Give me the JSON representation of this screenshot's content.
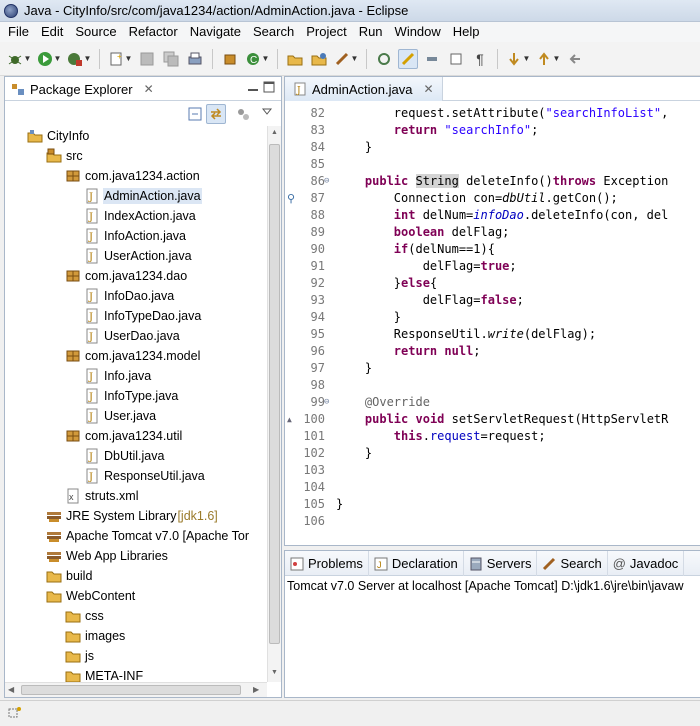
{
  "window": {
    "title": "Java - CityInfo/src/com/java1234/action/AdminAction.java - Eclipse"
  },
  "menu": [
    "File",
    "Edit",
    "Source",
    "Refactor",
    "Navigate",
    "Search",
    "Project",
    "Run",
    "Window",
    "Help"
  ],
  "package_explorer": {
    "title": "Package Explorer",
    "tree": [
      {
        "label": "CityInfo",
        "icon": "project-icon",
        "depth": 0
      },
      {
        "label": "src",
        "icon": "source-folder-icon",
        "depth": 1
      },
      {
        "label": "com.java1234.action",
        "icon": "package-icon",
        "depth": 2
      },
      {
        "label": "AdminAction.java",
        "icon": "java-file-icon",
        "depth": 3,
        "selected": true
      },
      {
        "label": "IndexAction.java",
        "icon": "java-file-icon",
        "depth": 3
      },
      {
        "label": "InfoAction.java",
        "icon": "java-file-icon",
        "depth": 3
      },
      {
        "label": "UserAction.java",
        "icon": "java-file-icon",
        "depth": 3
      },
      {
        "label": "com.java1234.dao",
        "icon": "package-icon",
        "depth": 2
      },
      {
        "label": "InfoDao.java",
        "icon": "java-file-icon",
        "depth": 3
      },
      {
        "label": "InfoTypeDao.java",
        "icon": "java-file-icon",
        "depth": 3
      },
      {
        "label": "UserDao.java",
        "icon": "java-file-icon",
        "depth": 3
      },
      {
        "label": "com.java1234.model",
        "icon": "package-icon",
        "depth": 2
      },
      {
        "label": "Info.java",
        "icon": "java-file-icon",
        "depth": 3
      },
      {
        "label": "InfoType.java",
        "icon": "java-file-icon",
        "depth": 3
      },
      {
        "label": "User.java",
        "icon": "java-file-icon",
        "depth": 3
      },
      {
        "label": "com.java1234.util",
        "icon": "package-icon",
        "depth": 2
      },
      {
        "label": "DbUtil.java",
        "icon": "java-file-icon",
        "depth": 3
      },
      {
        "label": "ResponseUtil.java",
        "icon": "java-file-icon",
        "depth": 3
      },
      {
        "label": "struts.xml",
        "icon": "xml-file-icon",
        "depth": 2
      },
      {
        "label": "JRE System Library",
        "suffix": "[jdk1.6]",
        "icon": "library-icon",
        "depth": 1
      },
      {
        "label": "Apache Tomcat v7.0 [Apache Tor",
        "icon": "library-icon",
        "depth": 1
      },
      {
        "label": "Web App Libraries",
        "icon": "library-icon",
        "depth": 1
      },
      {
        "label": "build",
        "icon": "folder-icon",
        "depth": 1
      },
      {
        "label": "WebContent",
        "icon": "folder-icon",
        "depth": 1
      },
      {
        "label": "css",
        "icon": "folder-icon",
        "depth": 2
      },
      {
        "label": "images",
        "icon": "folder-icon",
        "depth": 2
      },
      {
        "label": "js",
        "icon": "folder-icon",
        "depth": 2
      },
      {
        "label": "META-INF",
        "icon": "folder-icon",
        "depth": 2
      }
    ]
  },
  "editor": {
    "tab": "AdminAction.java",
    "lines": [
      {
        "n": "82",
        "html": "        request.setAttribute(<span class='str'>\"searchInfoList\"</span>, "
      },
      {
        "n": "83",
        "html": "        <span class='kw'>return</span> <span class='str'>\"searchInfo\"</span>;"
      },
      {
        "n": "84",
        "html": "    }"
      },
      {
        "n": "85",
        "html": ""
      },
      {
        "n": "86",
        "fold": true,
        "html": "    <span class='kw'>public</span> <span class='hl'>String</span> deleteInfo()<span class='kw'>throws</span> Exception"
      },
      {
        "n": "87",
        "marker": true,
        "html": "        Connection con=<span class='ital'>dbUtil</span>.getCon();"
      },
      {
        "n": "88",
        "html": "        <span class='kw'>int</span> delNum=<span class='fld ital'>infoDao</span>.deleteInfo(con, del"
      },
      {
        "n": "89",
        "html": "        <span class='kw'>boolean</span> delFlag;"
      },
      {
        "n": "90",
        "html": "        <span class='kw'>if</span>(delNum==1){"
      },
      {
        "n": "91",
        "html": "            delFlag=<span class='kw'>true</span>;"
      },
      {
        "n": "92",
        "html": "        }<span class='kw'>else</span>{"
      },
      {
        "n": "93",
        "html": "            delFlag=<span class='kw'>false</span>;"
      },
      {
        "n": "94",
        "html": "        }"
      },
      {
        "n": "95",
        "html": "        ResponseUtil.<span class='ital'>write</span>(delFlag);"
      },
      {
        "n": "96",
        "html": "        <span class='kw'>return</span> <span class='kw'>null</span>;"
      },
      {
        "n": "97",
        "html": "    }"
      },
      {
        "n": "98",
        "html": ""
      },
      {
        "n": "99",
        "fold": true,
        "html": "    <span class='ann'>@Override</span>"
      },
      {
        "n": "100",
        "override": true,
        "html": "    <span class='kw'>public</span> <span class='kw'>void</span> setServletRequest(HttpServletR"
      },
      {
        "n": "101",
        "html": "        <span class='kw'>this</span>.<span class='fld'>request</span>=request;"
      },
      {
        "n": "102",
        "html": "    }"
      },
      {
        "n": "103",
        "html": ""
      },
      {
        "n": "104",
        "html": ""
      },
      {
        "n": "105",
        "html": "}"
      },
      {
        "n": "106",
        "html": ""
      }
    ]
  },
  "bottom_panel": {
    "tabs": [
      {
        "label": "Problems",
        "icon": "problems-icon"
      },
      {
        "label": "Declaration",
        "icon": "declaration-icon"
      },
      {
        "label": "Servers",
        "icon": "servers-icon"
      },
      {
        "label": "Search",
        "icon": "search-icon"
      },
      {
        "label": "Javadoc",
        "icon": "javadoc-icon"
      }
    ],
    "console_line": "Tomcat v7.0 Server at localhost [Apache Tomcat] D:\\jdk1.6\\jre\\bin\\javaw"
  }
}
